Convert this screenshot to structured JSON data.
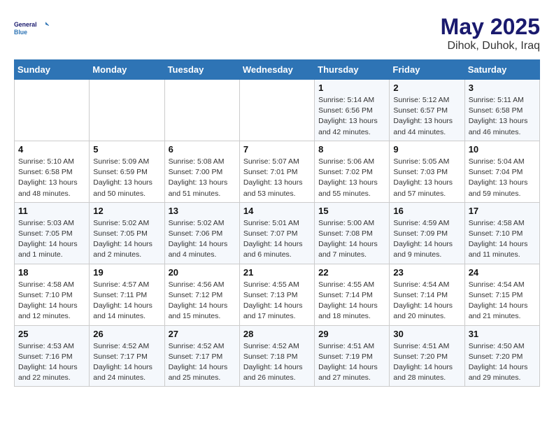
{
  "logo": {
    "line1": "General",
    "line2": "Blue"
  },
  "title": "May 2025",
  "subtitle": "Dihok, Duhok, Iraq",
  "weekdays": [
    "Sunday",
    "Monday",
    "Tuesday",
    "Wednesday",
    "Thursday",
    "Friday",
    "Saturday"
  ],
  "weeks": [
    [
      {
        "day": "",
        "info": ""
      },
      {
        "day": "",
        "info": ""
      },
      {
        "day": "",
        "info": ""
      },
      {
        "day": "",
        "info": ""
      },
      {
        "day": "1",
        "info": "Sunrise: 5:14 AM\nSunset: 6:56 PM\nDaylight: 13 hours\nand 42 minutes."
      },
      {
        "day": "2",
        "info": "Sunrise: 5:12 AM\nSunset: 6:57 PM\nDaylight: 13 hours\nand 44 minutes."
      },
      {
        "day": "3",
        "info": "Sunrise: 5:11 AM\nSunset: 6:58 PM\nDaylight: 13 hours\nand 46 minutes."
      }
    ],
    [
      {
        "day": "4",
        "info": "Sunrise: 5:10 AM\nSunset: 6:58 PM\nDaylight: 13 hours\nand 48 minutes."
      },
      {
        "day": "5",
        "info": "Sunrise: 5:09 AM\nSunset: 6:59 PM\nDaylight: 13 hours\nand 50 minutes."
      },
      {
        "day": "6",
        "info": "Sunrise: 5:08 AM\nSunset: 7:00 PM\nDaylight: 13 hours\nand 51 minutes."
      },
      {
        "day": "7",
        "info": "Sunrise: 5:07 AM\nSunset: 7:01 PM\nDaylight: 13 hours\nand 53 minutes."
      },
      {
        "day": "8",
        "info": "Sunrise: 5:06 AM\nSunset: 7:02 PM\nDaylight: 13 hours\nand 55 minutes."
      },
      {
        "day": "9",
        "info": "Sunrise: 5:05 AM\nSunset: 7:03 PM\nDaylight: 13 hours\nand 57 minutes."
      },
      {
        "day": "10",
        "info": "Sunrise: 5:04 AM\nSunset: 7:04 PM\nDaylight: 13 hours\nand 59 minutes."
      }
    ],
    [
      {
        "day": "11",
        "info": "Sunrise: 5:03 AM\nSunset: 7:05 PM\nDaylight: 14 hours\nand 1 minute."
      },
      {
        "day": "12",
        "info": "Sunrise: 5:02 AM\nSunset: 7:05 PM\nDaylight: 14 hours\nand 2 minutes."
      },
      {
        "day": "13",
        "info": "Sunrise: 5:02 AM\nSunset: 7:06 PM\nDaylight: 14 hours\nand 4 minutes."
      },
      {
        "day": "14",
        "info": "Sunrise: 5:01 AM\nSunset: 7:07 PM\nDaylight: 14 hours\nand 6 minutes."
      },
      {
        "day": "15",
        "info": "Sunrise: 5:00 AM\nSunset: 7:08 PM\nDaylight: 14 hours\nand 7 minutes."
      },
      {
        "day": "16",
        "info": "Sunrise: 4:59 AM\nSunset: 7:09 PM\nDaylight: 14 hours\nand 9 minutes."
      },
      {
        "day": "17",
        "info": "Sunrise: 4:58 AM\nSunset: 7:10 PM\nDaylight: 14 hours\nand 11 minutes."
      }
    ],
    [
      {
        "day": "18",
        "info": "Sunrise: 4:58 AM\nSunset: 7:10 PM\nDaylight: 14 hours\nand 12 minutes."
      },
      {
        "day": "19",
        "info": "Sunrise: 4:57 AM\nSunset: 7:11 PM\nDaylight: 14 hours\nand 14 minutes."
      },
      {
        "day": "20",
        "info": "Sunrise: 4:56 AM\nSunset: 7:12 PM\nDaylight: 14 hours\nand 15 minutes."
      },
      {
        "day": "21",
        "info": "Sunrise: 4:55 AM\nSunset: 7:13 PM\nDaylight: 14 hours\nand 17 minutes."
      },
      {
        "day": "22",
        "info": "Sunrise: 4:55 AM\nSunset: 7:14 PM\nDaylight: 14 hours\nand 18 minutes."
      },
      {
        "day": "23",
        "info": "Sunrise: 4:54 AM\nSunset: 7:14 PM\nDaylight: 14 hours\nand 20 minutes."
      },
      {
        "day": "24",
        "info": "Sunrise: 4:54 AM\nSunset: 7:15 PM\nDaylight: 14 hours\nand 21 minutes."
      }
    ],
    [
      {
        "day": "25",
        "info": "Sunrise: 4:53 AM\nSunset: 7:16 PM\nDaylight: 14 hours\nand 22 minutes."
      },
      {
        "day": "26",
        "info": "Sunrise: 4:52 AM\nSunset: 7:17 PM\nDaylight: 14 hours\nand 24 minutes."
      },
      {
        "day": "27",
        "info": "Sunrise: 4:52 AM\nSunset: 7:17 PM\nDaylight: 14 hours\nand 25 minutes."
      },
      {
        "day": "28",
        "info": "Sunrise: 4:52 AM\nSunset: 7:18 PM\nDaylight: 14 hours\nand 26 minutes."
      },
      {
        "day": "29",
        "info": "Sunrise: 4:51 AM\nSunset: 7:19 PM\nDaylight: 14 hours\nand 27 minutes."
      },
      {
        "day": "30",
        "info": "Sunrise: 4:51 AM\nSunset: 7:20 PM\nDaylight: 14 hours\nand 28 minutes."
      },
      {
        "day": "31",
        "info": "Sunrise: 4:50 AM\nSunset: 7:20 PM\nDaylight: 14 hours\nand 29 minutes."
      }
    ]
  ]
}
